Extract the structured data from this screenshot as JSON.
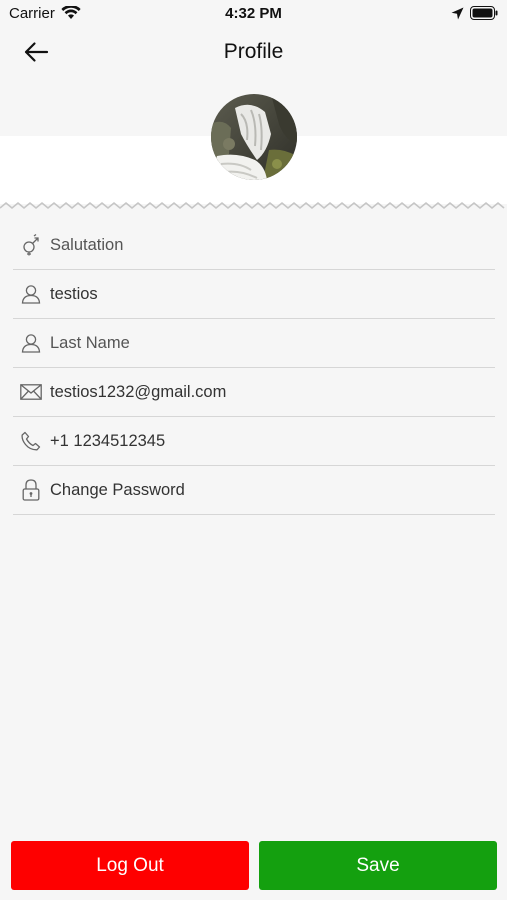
{
  "status_bar": {
    "carrier": "Carrier",
    "time": "4:32 PM"
  },
  "nav": {
    "title": "Profile",
    "back_icon": "arrow-left-icon"
  },
  "profile": {
    "avatar_icon": "avatar-photo"
  },
  "fields": [
    {
      "icon": "gender-icon",
      "value": "Salutation",
      "is_placeholder": true
    },
    {
      "icon": "user-icon",
      "value": "testios",
      "is_placeholder": false
    },
    {
      "icon": "user-icon",
      "value": "Last Name",
      "is_placeholder": true
    },
    {
      "icon": "envelope-icon",
      "value": "testios1232@gmail.com",
      "is_placeholder": false
    },
    {
      "icon": "phone-icon",
      "value": "+1  1234512345",
      "is_placeholder": false
    },
    {
      "icon": "lock-icon",
      "value": "Change Password",
      "is_placeholder": false
    }
  ],
  "buttons": {
    "logout_label": "Log Out",
    "save_label": "Save"
  },
  "colors": {
    "logout": "#fe0000",
    "save": "#14a00f",
    "background": "#f6f6f6"
  }
}
